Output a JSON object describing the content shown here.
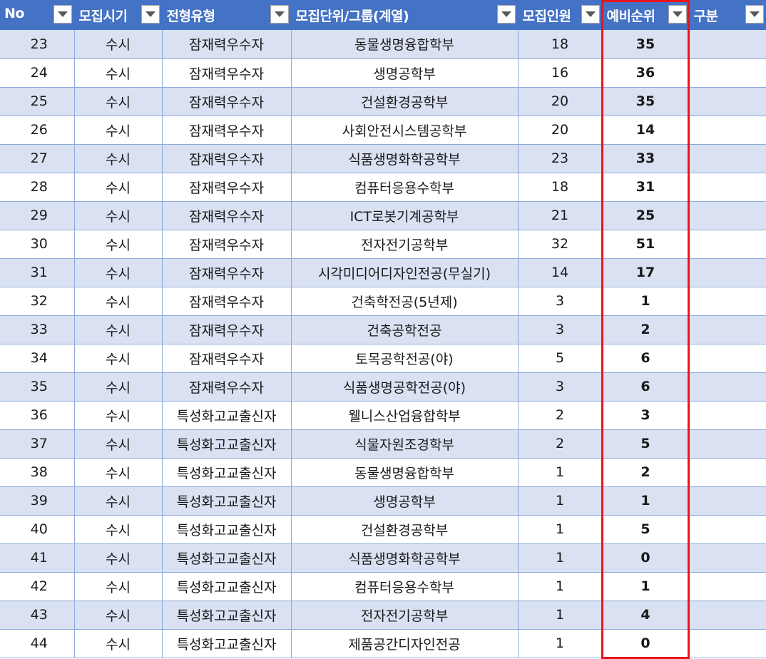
{
  "colors": {
    "header_bg": "#4472c4",
    "band_bg": "#d9e1f2",
    "highlight_border": "#e8141c"
  },
  "headers": [
    "No",
    "모집시기",
    "전형유형",
    "모집단위/그룹(계열)",
    "모집인원",
    "예비순위",
    "구분"
  ],
  "header_filter_icon": "dropdown-arrow-icon",
  "rows": [
    {
      "no": "23",
      "period": "수시",
      "type": "잠재력우수자",
      "unit": "동물생명융합학부",
      "quota": "18",
      "rank": "35",
      "category": ""
    },
    {
      "no": "24",
      "period": "수시",
      "type": "잠재력우수자",
      "unit": "생명공학부",
      "quota": "16",
      "rank": "36",
      "category": ""
    },
    {
      "no": "25",
      "period": "수시",
      "type": "잠재력우수자",
      "unit": "건설환경공학부",
      "quota": "20",
      "rank": "35",
      "category": ""
    },
    {
      "no": "26",
      "period": "수시",
      "type": "잠재력우수자",
      "unit": "사회안전시스템공학부",
      "quota": "20",
      "rank": "14",
      "category": ""
    },
    {
      "no": "27",
      "period": "수시",
      "type": "잠재력우수자",
      "unit": "식품생명화학공학부",
      "quota": "23",
      "rank": "33",
      "category": ""
    },
    {
      "no": "28",
      "period": "수시",
      "type": "잠재력우수자",
      "unit": "컴퓨터응용수학부",
      "quota": "18",
      "rank": "31",
      "category": ""
    },
    {
      "no": "29",
      "period": "수시",
      "type": "잠재력우수자",
      "unit": "ICT로봇기계공학부",
      "quota": "21",
      "rank": "25",
      "category": ""
    },
    {
      "no": "30",
      "period": "수시",
      "type": "잠재력우수자",
      "unit": "전자전기공학부",
      "quota": "32",
      "rank": "51",
      "category": ""
    },
    {
      "no": "31",
      "period": "수시",
      "type": "잠재력우수자",
      "unit": "시각미디어디자인전공(무실기)",
      "quota": "14",
      "rank": "17",
      "category": ""
    },
    {
      "no": "32",
      "period": "수시",
      "type": "잠재력우수자",
      "unit": "건축학전공(5년제)",
      "quota": "3",
      "rank": "1",
      "category": ""
    },
    {
      "no": "33",
      "period": "수시",
      "type": "잠재력우수자",
      "unit": "건축공학전공",
      "quota": "3",
      "rank": "2",
      "category": ""
    },
    {
      "no": "34",
      "period": "수시",
      "type": "잠재력우수자",
      "unit": "토목공학전공(야)",
      "quota": "5",
      "rank": "6",
      "category": ""
    },
    {
      "no": "35",
      "period": "수시",
      "type": "잠재력우수자",
      "unit": "식품생명공학전공(야)",
      "quota": "3",
      "rank": "6",
      "category": ""
    },
    {
      "no": "36",
      "period": "수시",
      "type": "특성화고교출신자",
      "unit": "웰니스산업융합학부",
      "quota": "2",
      "rank": "3",
      "category": ""
    },
    {
      "no": "37",
      "period": "수시",
      "type": "특성화고교출신자",
      "unit": "식물자원조경학부",
      "quota": "2",
      "rank": "5",
      "category": ""
    },
    {
      "no": "38",
      "period": "수시",
      "type": "특성화고교출신자",
      "unit": "동물생명융합학부",
      "quota": "1",
      "rank": "2",
      "category": ""
    },
    {
      "no": "39",
      "period": "수시",
      "type": "특성화고교출신자",
      "unit": "생명공학부",
      "quota": "1",
      "rank": "1",
      "category": ""
    },
    {
      "no": "40",
      "period": "수시",
      "type": "특성화고교출신자",
      "unit": "건설환경공학부",
      "quota": "1",
      "rank": "5",
      "category": ""
    },
    {
      "no": "41",
      "period": "수시",
      "type": "특성화고교출신자",
      "unit": "식품생명화학공학부",
      "quota": "1",
      "rank": "0",
      "category": ""
    },
    {
      "no": "42",
      "period": "수시",
      "type": "특성화고교출신자",
      "unit": "컴퓨터응용수학부",
      "quota": "1",
      "rank": "1",
      "category": ""
    },
    {
      "no": "43",
      "period": "수시",
      "type": "특성화고교출신자",
      "unit": "전자전기공학부",
      "quota": "1",
      "rank": "4",
      "category": ""
    },
    {
      "no": "44",
      "period": "수시",
      "type": "특성화고교출신자",
      "unit": "제품공간디자인전공",
      "quota": "1",
      "rank": "0",
      "category": ""
    }
  ]
}
